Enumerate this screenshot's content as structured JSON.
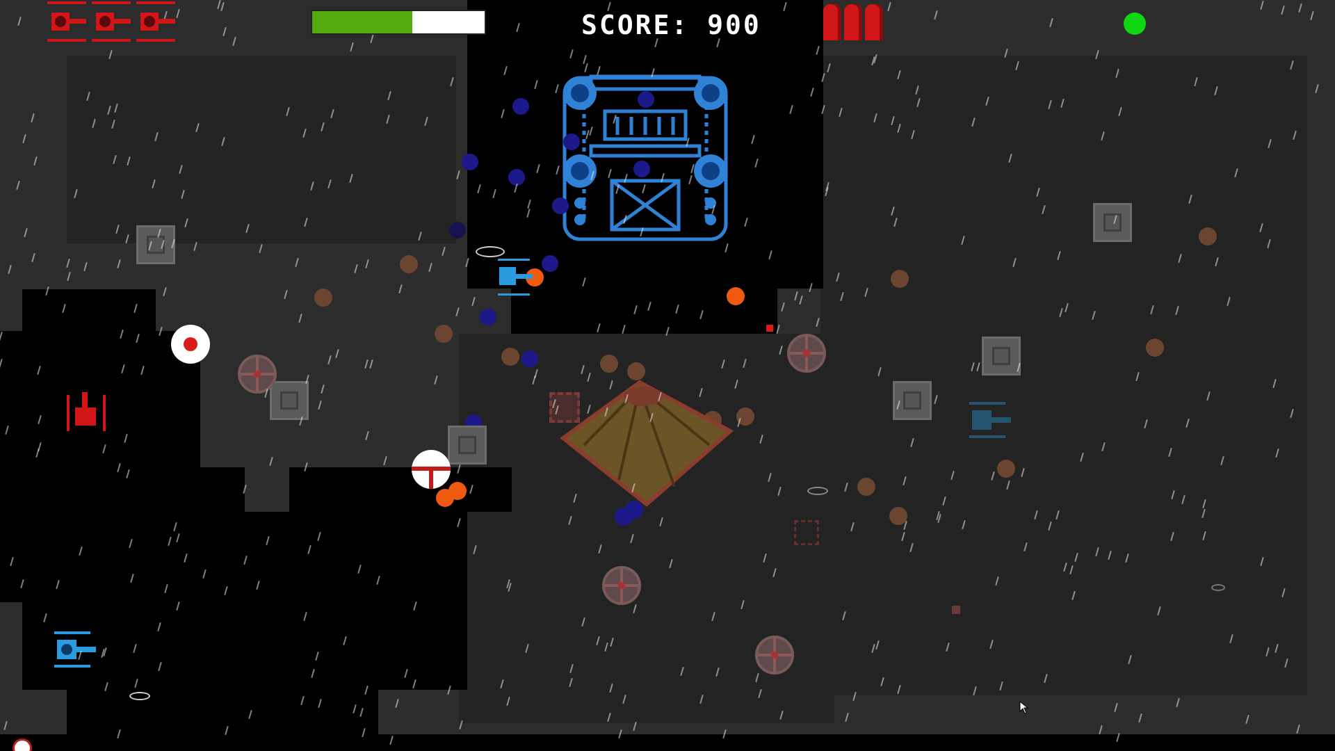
{
  "hud": {
    "score_label": "SCORE: 900",
    "health_fraction": 0.58,
    "lives_count": 3,
    "ammo_count": 3,
    "status_light_color": "#10d810"
  },
  "colors": {
    "player": "#2b9be0",
    "enemy": "#d01616",
    "boss": "#2f82d6",
    "boss_orb": "#1c1a8a",
    "fire_orb": "#ef5a10",
    "rock_orb": "#6b4530",
    "crate": "#5a5a5a",
    "health_fill": "#55aa10",
    "background": "#2c2c2c"
  },
  "icons": {
    "lives": "red-tank-icon",
    "ammo": "red-shell-icon",
    "status": "green-status-light",
    "cursor": "mouse-pointer-icon"
  }
}
